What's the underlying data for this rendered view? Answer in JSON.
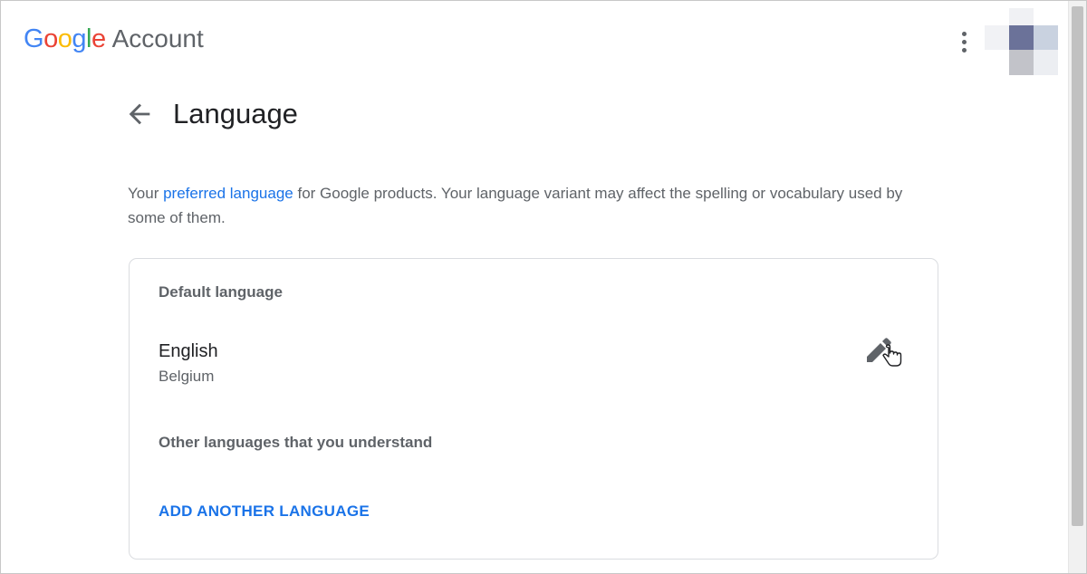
{
  "header": {
    "logo_letters": [
      "G",
      "o",
      "o",
      "g",
      "l",
      "e"
    ],
    "logo_colors": [
      "#4285F4",
      "#EA4335",
      "#FBBC05",
      "#4285F4",
      "#34A853",
      "#EA4335"
    ],
    "account_label": "Account",
    "menu_icon": "more-vert-icon",
    "avatar_icon": "pixelated-avatar"
  },
  "page": {
    "title": "Language",
    "back_icon": "arrow-back-icon"
  },
  "description": {
    "prefix": "Your ",
    "link_text": "preferred language",
    "suffix": " for Google products. Your language variant may affect the spelling or vocabulary used by some of them.",
    "link_color": "#1a73e8"
  },
  "card": {
    "default_label": "Default language",
    "default_language": {
      "name": "English",
      "region": "Belgium",
      "edit_icon": "pencil-icon"
    },
    "other_label": "Other languages that you understand",
    "add_button": "ADD ANOTHER LANGUAGE"
  },
  "colors": {
    "accent": "#1a73e8",
    "text_primary": "#202124",
    "text_secondary": "#5f6368",
    "border": "#dadce0"
  }
}
